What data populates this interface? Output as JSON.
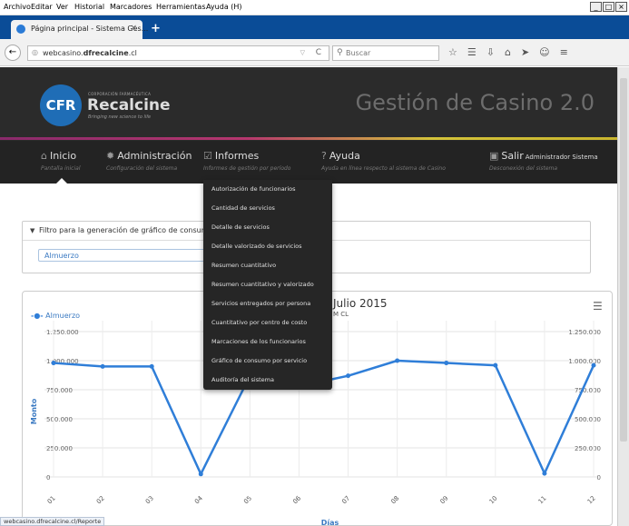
{
  "menubar": {
    "items": [
      "Archivo",
      "Editar",
      "Ver",
      "Historial",
      "Marcadores",
      "Herramientas",
      "Ayuda (H)"
    ],
    "window_buttons": [
      "_",
      "□",
      "×"
    ]
  },
  "tab": {
    "title": "Página principal - Sistema Ges...",
    "close": "×",
    "new": "+"
  },
  "navbar": {
    "back": "←",
    "url_prefix": "webcasino.",
    "url_domain": "dfrecalcine",
    "url_suffix": ".cl",
    "search_placeholder": "Buscar",
    "icons": [
      "☆",
      "☰",
      "⇩",
      "⌂",
      "➤",
      "☺",
      "≡"
    ]
  },
  "header": {
    "logo": "CFR",
    "corp": "CORPORACIÓN FARMACÉUTICA",
    "brand": "Recalcine",
    "tagline": "Bringing new science to life",
    "app_title": "Gestión de Casino 2.0"
  },
  "nav": {
    "inicio": {
      "label": "Inicio",
      "sub": "Pantalla inicial"
    },
    "admin": {
      "label": "Administración",
      "sub": "Configuración del sistema"
    },
    "informes": {
      "label": "Informes",
      "sub": "Informes de gestión por período"
    },
    "ayuda": {
      "label": "Ayuda",
      "sub": "Ayuda en línea respecto al sistema de Casino"
    },
    "salir": {
      "label": "Salir",
      "user": "Administrador Sistema",
      "sub": "Desconexión del sistema"
    }
  },
  "dropdown": {
    "items": [
      "Autorización de funcionarios",
      "Cantidad de servicios",
      "Detalle de servicios",
      "Detalle valorizado de servicios",
      "Resumen cuantitativo",
      "Resumen cuantitativo y valorizado",
      "Servicios entregados por persona",
      "Cuantitativo por centro de costo",
      "Marcaciones de los funcionarios",
      "Gráfico de consumo por servicio",
      "Auditoría del sistema"
    ]
  },
  "filter": {
    "title": "Filtro para la generación de gráfico de consum",
    "selected": "Almuerzo"
  },
  "chart_header": {
    "title": "Julio 2015",
    "subtitle": "M CL"
  },
  "statusbar": "webcasino.dfrecalcine.cl/Reporte",
  "chart_data": {
    "type": "line",
    "title": "Julio 2015",
    "xlabel": "Días",
    "ylabel": "Monto",
    "ylim": [
      0,
      1250000
    ],
    "yticks": [
      "1.250.000",
      "1.000.000",
      "750.000",
      "500.000",
      "250.000",
      "0"
    ],
    "ytick_values": [
      1250000,
      1000000,
      750000,
      500000,
      250000,
      0
    ],
    "categories": [
      "01",
      "02",
      "03",
      "04",
      "05",
      "06",
      "07",
      "08",
      "09",
      "10",
      "11",
      "12"
    ],
    "series": [
      {
        "name": "Almuerzo",
        "values": [
          980000,
          950000,
          950000,
          25000,
          870000,
          780000,
          870000,
          1000000,
          980000,
          960000,
          30000,
          960000
        ]
      }
    ],
    "legend": "top-left",
    "grid": true,
    "color": "#2f7ed8"
  }
}
